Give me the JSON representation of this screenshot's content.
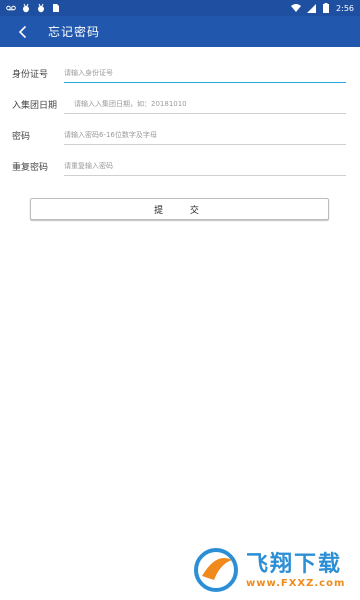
{
  "status_bar": {
    "time": "2:56",
    "left_icons": [
      "voicemail-icon",
      "bug-icon",
      "bug-icon",
      "sim-icon"
    ],
    "right_icons": [
      "wifi-icon",
      "signal-icon",
      "battery-icon"
    ]
  },
  "app_bar": {
    "back_glyph": "‹",
    "title": "忘记密码"
  },
  "form": {
    "id_card": {
      "label": "身份证号",
      "placeholder": "请输入身份证号"
    },
    "join_date": {
      "label": "入集团日期",
      "placeholder": "请输入入集团日期，如：20181010"
    },
    "password": {
      "label": "密码",
      "placeholder": "请输入密码6-16位数字及字母"
    },
    "confirm_password": {
      "label": "重复密码",
      "placeholder": "请重复输入密码"
    },
    "submit_label": "提 交"
  },
  "watermark": {
    "text": "飞翔下载",
    "url": "www.FXXZ.com"
  },
  "colors": {
    "status_bar": "#1e4fa0",
    "app_bar": "#2157ad",
    "active_underline": "#2aa9e0",
    "inactive_underline": "#cfcfcf"
  }
}
